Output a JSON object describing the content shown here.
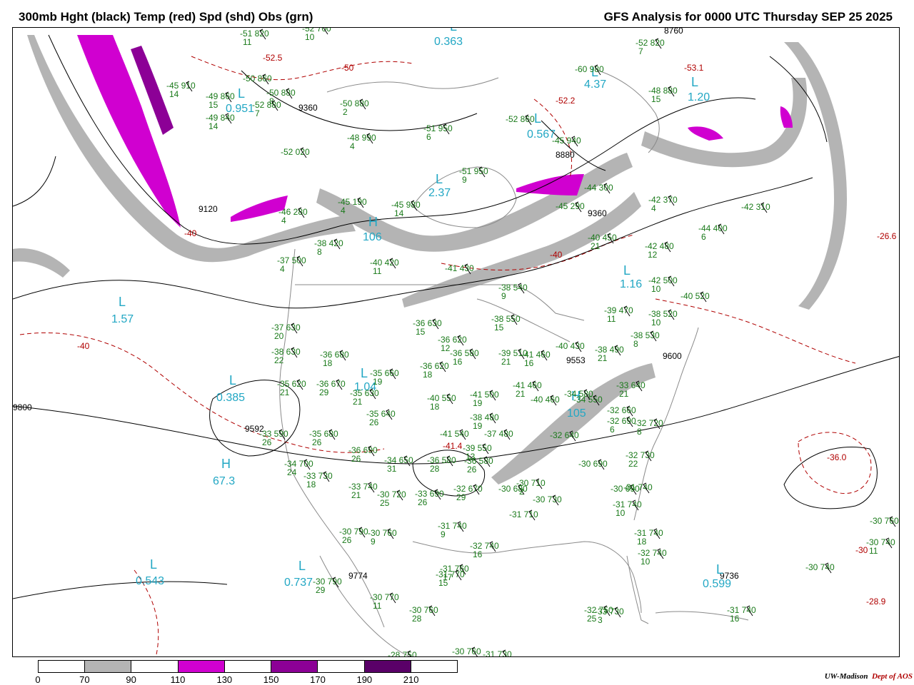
{
  "header": {
    "title_left": "300mb Hght (black) Temp (red) Spd (shd) Obs (grn)",
    "title_right": "GFS Analysis for 0000 UTC Thursday  SEP 25 2025"
  },
  "credit": {
    "org": "UW-Madison",
    "dept": "Dept of AOS"
  },
  "colors": {
    "height_contour": "#000000",
    "temp_contour": "#b00000",
    "obs": "#1a7a1a",
    "center_label": "#22a7c4",
    "land_borders": "#8a8a8a",
    "speed_70_90": "#b4b4b4",
    "speed_110_130": "#d000d0",
    "speed_150_170": "#8c0096",
    "speed_190_210": "#5a0068"
  },
  "colorbar": {
    "segments": [
      "#ffffff",
      "#b4b4b4",
      "#ffffff",
      "#d000d0",
      "#ffffff",
      "#8c0096",
      "#ffffff",
      "#5a0068",
      "#ffffff"
    ],
    "ticks": [
      "0",
      "70",
      "90",
      "110",
      "130",
      "150",
      "170",
      "190",
      "210"
    ]
  },
  "centers": [
    {
      "type": "L",
      "value": "1.57"
    },
    {
      "type": "L",
      "value": "0.385"
    },
    {
      "type": "H",
      "value": "67.3"
    },
    {
      "type": "L",
      "value": "0.543"
    },
    {
      "type": "L",
      "value": "0.737"
    },
    {
      "type": "L",
      "value": "1.04"
    },
    {
      "type": "H",
      "value": "106"
    },
    {
      "type": "L",
      "value": "2.37"
    },
    {
      "type": "L",
      "value": "0.567"
    },
    {
      "type": "L",
      "value": "4.37"
    },
    {
      "type": "L",
      "value": "1.20"
    },
    {
      "type": "L",
      "value": "1.16"
    },
    {
      "type": "H",
      "value": "105"
    },
    {
      "type": "L",
      "value": "0.599"
    },
    {
      "type": "L",
      "value": "0.363"
    },
    {
      "type": "L",
      "value": "0.951"
    }
  ],
  "height_labels": [
    "9120",
    "9360",
    "9600",
    "9774",
    "9736",
    "9592",
    "9553",
    "9360",
    "8880",
    "8760",
    "9800"
  ],
  "temp_labels": [
    "-52.5",
    "-50",
    "-40",
    "-40",
    "-40",
    "-53.1",
    "-52.2",
    "-26.6",
    "-36.0",
    "-28.9",
    "-30",
    "-41.4"
  ],
  "stations": [
    {
      "t": "-51",
      "h": "820",
      "s": "11"
    },
    {
      "t": "-52",
      "h": "700",
      "s": "10"
    },
    {
      "t": "-45",
      "h": "910",
      "s": "14"
    },
    {
      "t": "-49",
      "h": "860",
      "s": "15"
    },
    {
      "t": "-49",
      "h": "840",
      "s": "14"
    },
    {
      "t": "-50",
      "h": "860",
      "s": ""
    },
    {
      "t": "-50",
      "h": "880",
      "s": "8"
    },
    {
      "t": "-52",
      "h": "880",
      "s": "7"
    },
    {
      "t": "-50",
      "h": "880",
      "s": "2"
    },
    {
      "t": "-48",
      "h": "990",
      "s": "4"
    },
    {
      "t": "-51",
      "h": "950",
      "s": "6"
    },
    {
      "t": "-51",
      "h": "950",
      "s": "9"
    },
    {
      "t": "-52",
      "h": "020",
      "s": ""
    },
    {
      "t": "-52",
      "h": "860",
      "s": ""
    },
    {
      "t": "-45",
      "h": "940",
      "s": ""
    },
    {
      "t": "-60",
      "h": "980",
      "s": ""
    },
    {
      "t": "-52",
      "h": "820",
      "s": "7"
    },
    {
      "t": "-48",
      "h": "880",
      "s": "15"
    },
    {
      "t": "-46",
      "h": "280",
      "s": "4"
    },
    {
      "t": "-45",
      "h": "190",
      "s": "4"
    },
    {
      "t": "-45",
      "h": "980",
      "s": "14"
    },
    {
      "t": "-44",
      "h": "300",
      "s": ""
    },
    {
      "t": "-45",
      "h": "290",
      "s": ""
    },
    {
      "t": "-42",
      "h": "370",
      "s": "4"
    },
    {
      "t": "-44",
      "h": "400",
      "s": "6"
    },
    {
      "t": "-42",
      "h": "310",
      "s": ""
    },
    {
      "t": "-40",
      "h": "450",
      "s": "21"
    },
    {
      "t": "-42",
      "h": "480",
      "s": "12"
    },
    {
      "t": "-38",
      "h": "420",
      "s": "8"
    },
    {
      "t": "-37",
      "h": "500",
      "s": "4"
    },
    {
      "t": "-40",
      "h": "420",
      "s": "11"
    },
    {
      "t": "-41",
      "h": "430",
      "s": ""
    },
    {
      "t": "-38",
      "h": "540",
      "s": "9"
    },
    {
      "t": "-42",
      "h": "500",
      "s": "10"
    },
    {
      "t": "-40",
      "h": "520",
      "s": ""
    },
    {
      "t": "-39",
      "h": "470",
      "s": "11"
    },
    {
      "t": "-38",
      "h": "520",
      "s": "10"
    },
    {
      "t": "-36",
      "h": "630",
      "s": "15"
    },
    {
      "t": "-37",
      "h": "630",
      "s": "20"
    },
    {
      "t": "-38",
      "h": "550",
      "s": "15"
    },
    {
      "t": "-38",
      "h": "630",
      "s": "22"
    },
    {
      "t": "-36",
      "h": "680",
      "s": "18"
    },
    {
      "t": "-36",
      "h": "620",
      "s": "12"
    },
    {
      "t": "-36",
      "h": "580",
      "s": "16"
    },
    {
      "t": "-39",
      "h": "510",
      "s": "21"
    },
    {
      "t": "-41",
      "h": "460",
      "s": "16"
    },
    {
      "t": "-38",
      "h": "530",
      "s": "8"
    },
    {
      "t": "-38",
      "h": "490",
      "s": "21"
    },
    {
      "t": "-36",
      "h": "620",
      "s": "18"
    },
    {
      "t": "-35",
      "h": "660",
      "s": "19"
    },
    {
      "t": "-35",
      "h": "620",
      "s": "21"
    },
    {
      "t": "-36",
      "h": "670",
      "s": "29"
    },
    {
      "t": "-35",
      "h": "630",
      "s": "21"
    },
    {
      "t": "-40",
      "h": "430",
      "s": ""
    },
    {
      "t": "-41",
      "h": "460",
      "s": "21"
    },
    {
      "t": "-40",
      "h": "460",
      "s": ""
    },
    {
      "t": "-40",
      "h": "550",
      "s": "18"
    },
    {
      "t": "-41",
      "h": "500",
      "s": "19"
    },
    {
      "t": "-34",
      "h": "550",
      "s": ""
    },
    {
      "t": "-33",
      "h": "640",
      "s": "21"
    },
    {
      "t": "-34",
      "h": "580",
      "s": ""
    },
    {
      "t": "-35",
      "h": "640",
      "s": "26"
    },
    {
      "t": "-38",
      "h": "480",
      "s": "19"
    },
    {
      "t": "-41",
      "h": "540",
      "s": ""
    },
    {
      "t": "-37",
      "h": "480",
      "s": ""
    },
    {
      "t": "-32",
      "h": "660",
      "s": ""
    },
    {
      "t": "-33",
      "h": "590",
      "s": "26"
    },
    {
      "t": "-35",
      "h": "680",
      "s": "26"
    },
    {
      "t": "-36",
      "h": "690",
      "s": "26"
    },
    {
      "t": "-34",
      "h": "650",
      "s": "31"
    },
    {
      "t": "-36",
      "h": "580",
      "s": "28"
    },
    {
      "t": "-36",
      "h": "580",
      "s": "26"
    },
    {
      "t": "-39",
      "h": "550",
      "s": "13"
    },
    {
      "t": "-32",
      "h": "640",
      "s": ""
    },
    {
      "t": "-32",
      "h": "690",
      "s": "6"
    },
    {
      "t": "-32",
      "h": "720",
      "s": "8"
    },
    {
      "t": "-32",
      "h": "730",
      "s": "22"
    },
    {
      "t": "-34",
      "h": "700",
      "s": "24"
    },
    {
      "t": "-33",
      "h": "730",
      "s": "18"
    },
    {
      "t": "-33",
      "h": "740",
      "s": "21"
    },
    {
      "t": "-30",
      "h": "720",
      "s": "25"
    },
    {
      "t": "-33",
      "h": "690",
      "s": "26"
    },
    {
      "t": "-32",
      "h": "670",
      "s": "29"
    },
    {
      "t": "-30",
      "h": "680",
      "s": ""
    },
    {
      "t": "-30",
      "h": "710",
      "s": "2"
    },
    {
      "t": "-30",
      "h": "690",
      "s": ""
    },
    {
      "t": "-30",
      "h": "690",
      "s": ""
    },
    {
      "t": "-31",
      "h": "740",
      "s": ""
    },
    {
      "t": "-31",
      "h": "740",
      "s": "10"
    },
    {
      "t": "-30",
      "h": "730",
      "s": ""
    },
    {
      "t": "-31",
      "h": "710",
      "s": ""
    },
    {
      "t": "-31",
      "h": "740",
      "s": "9"
    },
    {
      "t": "-30",
      "h": "760",
      "s": "9"
    },
    {
      "t": "-30",
      "h": "790",
      "s": "26"
    },
    {
      "t": "-32",
      "h": "740",
      "s": "16"
    },
    {
      "t": "-31",
      "h": "740",
      "s": "18"
    },
    {
      "t": "-32",
      "h": "740",
      "s": "10"
    },
    {
      "t": "-31",
      "h": "760",
      "s": "17"
    },
    {
      "t": "-31",
      "h": "770",
      "s": "15"
    },
    {
      "t": "-30",
      "h": "790",
      "s": "29"
    },
    {
      "t": "-30",
      "h": "770",
      "s": "11"
    },
    {
      "t": "-30",
      "h": "760",
      "s": "28"
    },
    {
      "t": "-32",
      "h": "750",
      "s": "25"
    },
    {
      "t": "-33",
      "h": "730",
      "s": "3"
    },
    {
      "t": "-31",
      "h": "740",
      "s": "16"
    },
    {
      "t": "-30",
      "h": "740",
      "s": ""
    },
    {
      "t": "-30",
      "h": "760",
      "s": ""
    },
    {
      "t": "-30",
      "h": "740",
      "s": "11"
    },
    {
      "t": "-28",
      "h": "750",
      "s": ""
    },
    {
      "t": "-30",
      "h": "760",
      "s": ""
    },
    {
      "t": "-31",
      "h": "730",
      "s": ""
    }
  ]
}
